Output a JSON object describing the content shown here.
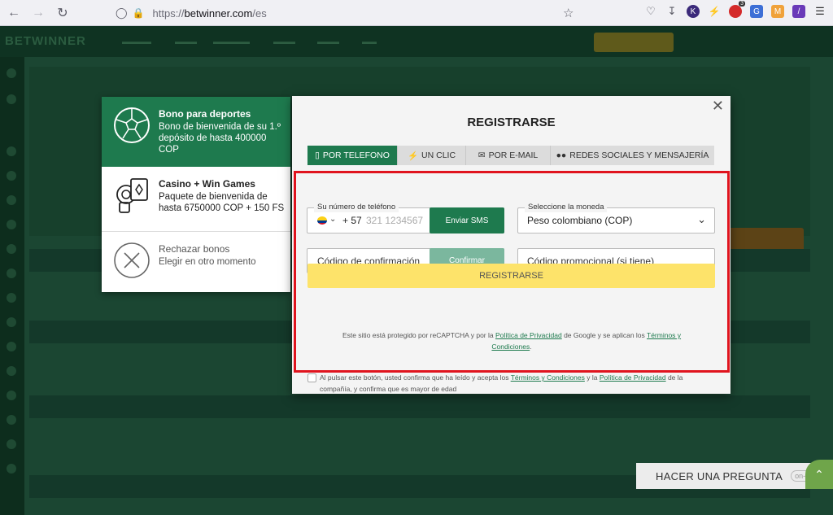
{
  "browser": {
    "url_prefix": "https://",
    "url_host": "betwinner.com",
    "url_path": "/es",
    "ext_badge": "3"
  },
  "chat": {
    "label": "HACER UNA PREGUNTA",
    "status": "on-line"
  },
  "bonus_panel": {
    "items": [
      {
        "title": "Bono para deportes",
        "lines": [
          "Bono de bienvenida de su 1.º",
          "depósito de hasta 400000",
          "COP"
        ]
      },
      {
        "title": "Casino + Win Games",
        "lines": [
          "Paquete de bienvenida de",
          "hasta 6750000 COP + 150 FS"
        ]
      },
      {
        "title": "Rechazar bonos",
        "lines": [
          "Elegir en otro momento"
        ]
      }
    ]
  },
  "modal": {
    "title": "REGISTRARSE",
    "close": "✕",
    "tabs": [
      {
        "label": "POR TELEFONO",
        "icon": "phone-icon"
      },
      {
        "label": "UN CLIC",
        "icon": "bolt-icon"
      },
      {
        "label": "POR E-MAIL",
        "icon": "envelope-icon"
      },
      {
        "label": "REDES SOCIALES Y MENSAJERÍA",
        "icon": "users-icon"
      }
    ],
    "phone": {
      "label": "Su número de teléfono",
      "code": "+ 57",
      "placeholder": "321 1234567",
      "sms_button": "Enviar SMS"
    },
    "currency": {
      "label": "Seleccione la moneda",
      "value": "Peso colombiano (COP)"
    },
    "confirm": {
      "placeholder": "Código de confirmación",
      "button": "Confirmar"
    },
    "promo": {
      "placeholder": "Código promocional (si tiene)"
    },
    "submit": "REGISTRARSE",
    "recaptcha": {
      "pre": "Este sitio está protegido por reCAPTCHA y por la ",
      "privacy": "Política de Privacidad",
      "mid": " de Google y se aplican los ",
      "terms_a": "Términos y",
      "terms_b": "Condiciones",
      "post": "."
    },
    "consent": {
      "pre": "Al pulsar este botón, usted confirma que ha leído y acepta los ",
      "terms": "Términos y Condiciones",
      "mid": " y la ",
      "privacy": "Política de Privacidad",
      "post": " de la",
      "line2": "compañía, y confirma que es mayor de edad"
    }
  },
  "colors": {
    "accent_green": "#1e7a4e",
    "yellow": "#fde36a",
    "highlight_red": "#e0141e"
  }
}
